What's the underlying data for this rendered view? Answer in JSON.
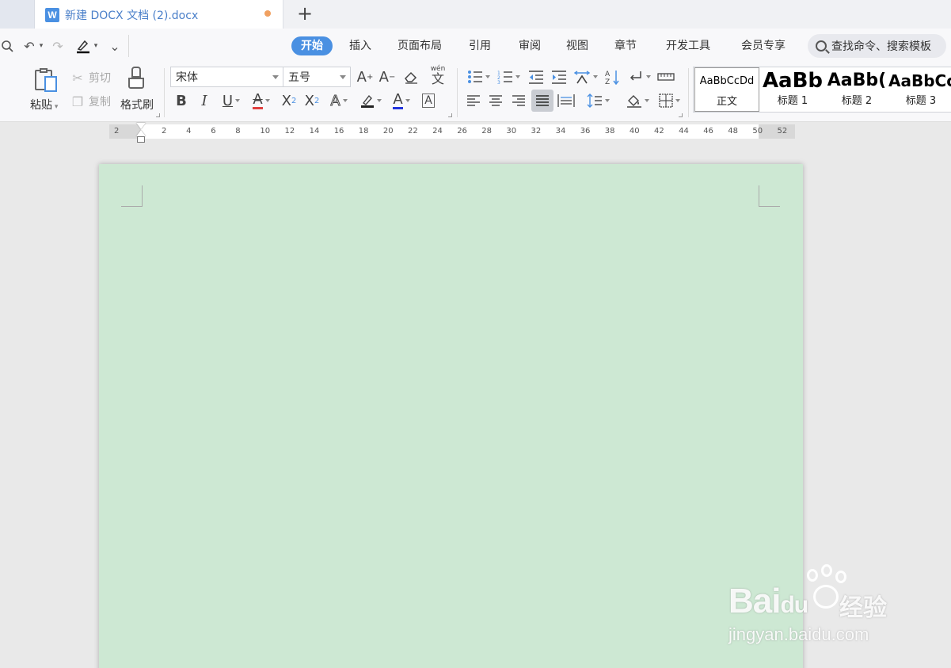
{
  "tab": {
    "app_icon_letter": "W",
    "title": "新建 DOCX 文档 (2).docx",
    "new_tab_symbol": "+"
  },
  "quick_access": {
    "undo_symbol": "↶",
    "redo_symbol": "↷",
    "more_symbol": "⌄"
  },
  "menu": {
    "tabs": [
      "开始",
      "插入",
      "页面布局",
      "引用",
      "审阅",
      "视图",
      "章节",
      "开发工具",
      "会员专享"
    ],
    "active": "开始",
    "search_text": "查找命令、搜索模板"
  },
  "clipboard": {
    "paste_label": "粘贴",
    "cut_label": "剪切",
    "copy_label": "复制",
    "format_painter_label": "格式刷"
  },
  "font": {
    "family_value": "宋体",
    "size_value": "五号",
    "grow_symbol": "A",
    "shrink_symbol": "A",
    "pinyin_top": "wén",
    "pinyin_char": "文",
    "bold": "B",
    "italic": "I",
    "underline": "U",
    "strike": "A",
    "superscript_base": "X",
    "superscript_exp": "2",
    "subscript_base": "X",
    "subscript_exp": "2",
    "text_effect": "A",
    "font_color": "A",
    "char_border": "A"
  },
  "styles": [
    {
      "preview": "AaBbCcDd",
      "name": "正文"
    },
    {
      "preview": "AaBb",
      "name": "标题 1"
    },
    {
      "preview": "AaBb(",
      "name": "标题 2"
    },
    {
      "preview": "AaBbCc",
      "name": "标题 3"
    }
  ],
  "ruler": {
    "ticks": [
      "2",
      "2",
      "4",
      "6",
      "8",
      "10",
      "12",
      "14",
      "16",
      "18",
      "20",
      "22",
      "24",
      "26",
      "28",
      "30",
      "32",
      "34",
      "36",
      "38",
      "40",
      "42",
      "44",
      "46",
      "48",
      "50",
      "52"
    ]
  },
  "colors": {
    "accent": "#4a90e2",
    "page_background": "#cde8d3",
    "workspace": "#e9e9e9"
  },
  "watermark": {
    "brand_text": "Bai",
    "brand_suffix": "du",
    "product_text": "经验",
    "url": "jingyan.baidu.com"
  }
}
